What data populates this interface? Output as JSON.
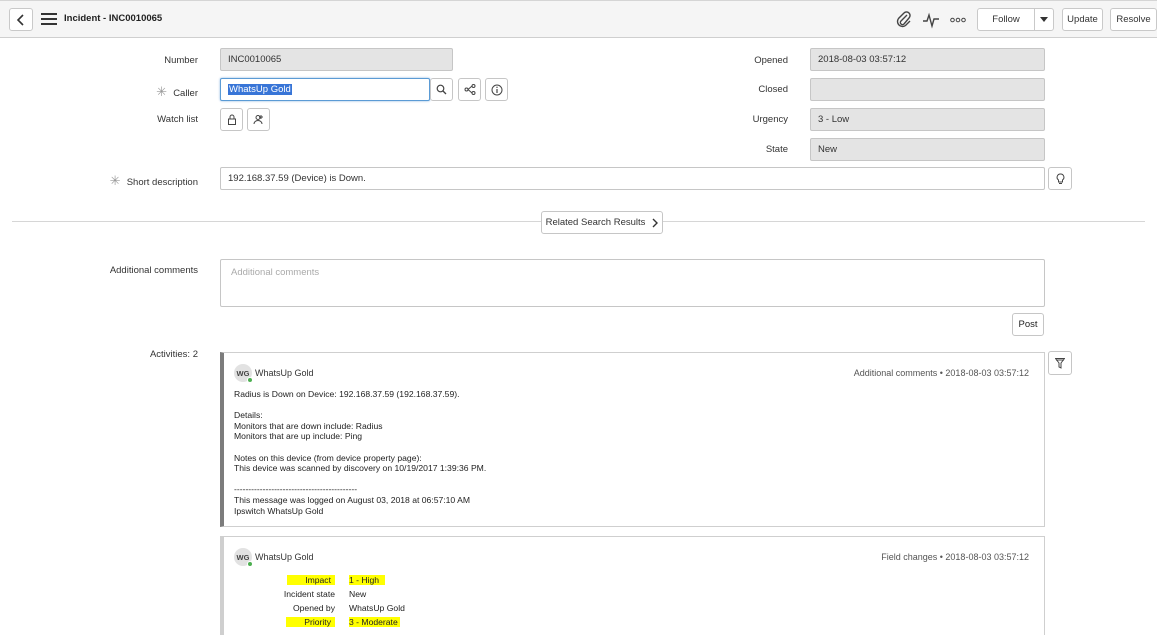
{
  "header": {
    "title": "Incident - INC0010065",
    "follow_label": "Follow",
    "update_label": "Update",
    "resolve_label": "Resolve"
  },
  "form": {
    "number_label": "Number",
    "number_value": "INC0010065",
    "caller_label": "Caller",
    "caller_value": "WhatsUp Gold",
    "watchlist_label": "Watch list",
    "short_desc_label": "Short description",
    "short_desc_value": "192.168.37.59 (Device) is Down.",
    "opened_label": "Opened",
    "opened_value": "2018-08-03 03:57:12",
    "closed_label": "Closed",
    "closed_value": "",
    "urgency_label": "Urgency",
    "urgency_value": "3 - Low",
    "state_label": "State",
    "state_value": "New",
    "related_label": "Related Search Results",
    "comments_label": "Additional comments",
    "comments_placeholder": "Additional comments",
    "post_label": "Post",
    "activities_label": "Activities: 2"
  },
  "activities": [
    {
      "avatar": "WG",
      "author": "WhatsUp Gold",
      "meta": "Additional comments  •  2018-08-03 03:57:12",
      "body": "Radius is Down on Device: 192.168.37.59 (192.168.37.59).\n\nDetails:\nMonitors that are down include: Radius\nMonitors that are up include: Ping\n\nNotes on this device (from device property page):\nThis device was scanned by discovery on 10/19/2017 1:39:36 PM.\n\n-------------------------------------------\nThis message was logged on August 03, 2018 at 06:57:10 AM\nIpswitch WhatsUp Gold"
    },
    {
      "avatar": "WG",
      "author": "WhatsUp Gold",
      "meta": "Field changes  •  2018-08-03 03:57:12",
      "changes": [
        {
          "label": "Impact",
          "value": "1 - High",
          "highlight": true
        },
        {
          "label": "Incident state",
          "value": "New",
          "highlight": false
        },
        {
          "label": "Opened by",
          "value": "WhatsUp Gold",
          "highlight": false
        },
        {
          "label": "Priority",
          "value": "3 - Moderate",
          "highlight": true
        }
      ]
    }
  ],
  "colors": {
    "highlight": "#ffff00",
    "online_dot": "#4caf50",
    "focus_border": "#5b9bd5"
  },
  "icons": [
    "back-icon",
    "menu-icon",
    "paperclip-icon",
    "activity-icon",
    "more-icon",
    "chevron-down-icon",
    "search-icon",
    "hierarchy-icon",
    "info-icon",
    "lock-icon",
    "add-user-icon",
    "lightbulb-icon",
    "chevron-right-icon",
    "filter-icon"
  ]
}
